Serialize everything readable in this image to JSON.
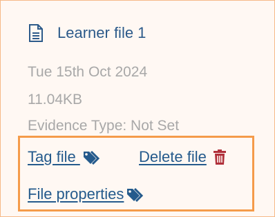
{
  "file": {
    "icon": "document-icon",
    "title": "Learner file 1",
    "date": "Tue 15th Oct 2024",
    "size": "11.04KB",
    "evidence_type": "Evidence Type: Not Set"
  },
  "actions": {
    "tag_label": "Tag file ",
    "delete_label": "Delete file",
    "properties_label": "File properties"
  },
  "colors": {
    "link": "#245a8c",
    "muted_text": "#a8a8a8",
    "card_border": "#f6b987",
    "highlight_border": "#f59b4a",
    "delete_icon": "#b0303a"
  }
}
